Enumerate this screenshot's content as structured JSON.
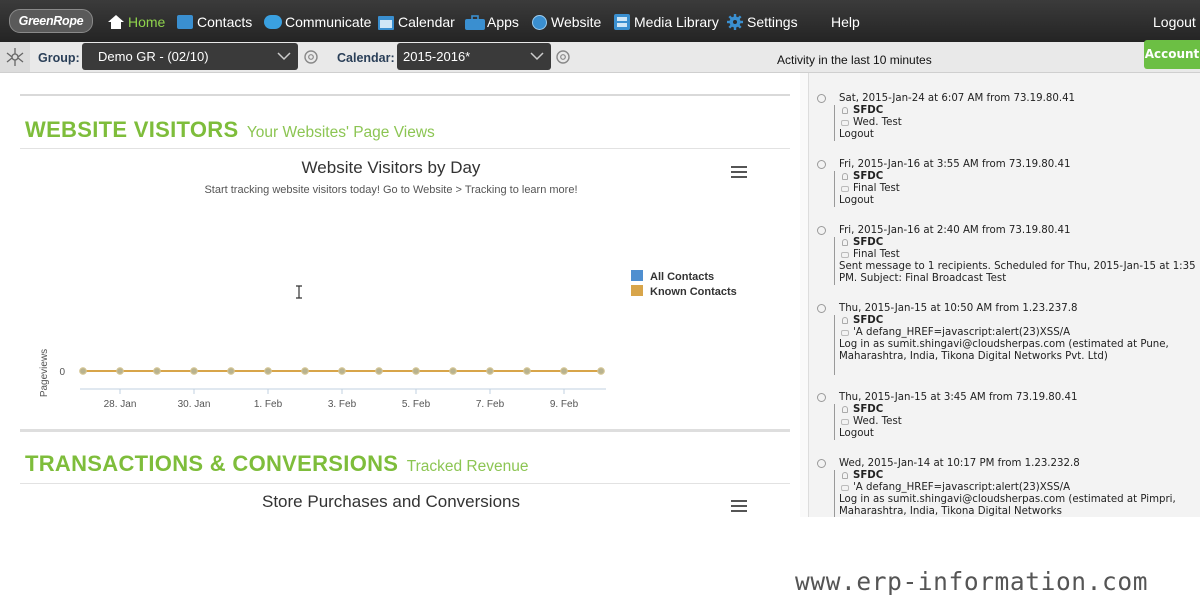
{
  "app": {
    "logo": "GreenRope"
  },
  "nav": {
    "items": [
      {
        "label": "Home",
        "icon": "home-icon"
      },
      {
        "label": "Contacts",
        "icon": "contacts-icon"
      },
      {
        "label": "Communicate",
        "icon": "chat-bubble-icon"
      },
      {
        "label": "Calendar",
        "icon": "calendar-icon"
      },
      {
        "label": "Apps",
        "icon": "briefcase-icon"
      },
      {
        "label": "Website",
        "icon": "globe-icon"
      },
      {
        "label": "Media Library",
        "icon": "media-icon"
      },
      {
        "label": "Settings",
        "icon": "gear-icon"
      },
      {
        "label": "Help",
        "icon": ""
      }
    ],
    "logout": "Logout"
  },
  "subbar": {
    "group_label": "Group:",
    "group_value": "Demo GR - (02/10)",
    "calendar_label": "Calendar:",
    "calendar_value": "2015-2016*",
    "activity_title": "Activity in the last 10 minutes",
    "account_button": "Account"
  },
  "sections": [
    {
      "title": "WEBSITE VISITORS",
      "subtitle": "Your Websites' Page Views"
    },
    {
      "title": "TRANSACTIONS & CONVERSIONS",
      "subtitle": "Tracked Revenue"
    }
  ],
  "chart_data": {
    "type": "line",
    "title": "Website Visitors by Day",
    "subtitle": "Start tracking website visitors today! Go to Website > Tracking to learn more!",
    "ylabel": "Pageviews",
    "xlabel": "",
    "x_tick_labels": [
      "28. Jan",
      "30. Jan",
      "1. Feb",
      "3. Feb",
      "5. Feb",
      "7. Feb",
      "9. Feb"
    ],
    "x_start_day": 27,
    "x_end_day": 41,
    "y_ticks": [
      0
    ],
    "series": [
      {
        "name": "All Contacts",
        "color": "#4f8fd0",
        "values": [
          0,
          0,
          0,
          0,
          0,
          0,
          0,
          0,
          0,
          0,
          0,
          0,
          0,
          0,
          0
        ]
      },
      {
        "name": "Known Contacts",
        "color": "#d8a54a",
        "values": [
          0,
          0,
          0,
          0,
          0,
          0,
          0,
          0,
          0,
          0,
          0,
          0,
          0,
          0,
          0
        ]
      }
    ],
    "legend_position": "right",
    "grid": false
  },
  "second_chart": {
    "title": "Store Purchases and Conversions"
  },
  "activity": [
    {
      "header": "Sat, 2015-Jan-24 at 6:07 AM from 73.19.80.41",
      "user": "SFDC",
      "context": "Wed. Test",
      "message": "Logout"
    },
    {
      "header": "Fri, 2015-Jan-16 at 3:55 AM from 73.19.80.41",
      "user": "SFDC",
      "context": "Final Test",
      "message": "Logout"
    },
    {
      "header": "Fri, 2015-Jan-16 at 2:40 AM from 73.19.80.41",
      "user": "SFDC",
      "context": "Final Test",
      "message": "Sent message to 1 recipients. Scheduled for Thu, 2015-Jan-15 at 1:35 PM. Subject: Final Broadcast Test"
    },
    {
      "header": "Thu, 2015-Jan-15 at 10:50 AM from 1.23.237.8",
      "user": "SFDC",
      "context": "'A defang_HREF=javascript:alert(23)XSS/A",
      "message": "Log in as sumit.shingavi@cloudsherpas.com (estimated at Pune, Maharashtra, India, Tikona Digital Networks Pvt. Ltd)"
    },
    {
      "header": "Thu, 2015-Jan-15 at 3:45 AM from 73.19.80.41",
      "user": "SFDC",
      "context": "Wed. Test",
      "message": "Logout"
    },
    {
      "header": "Wed, 2015-Jan-14 at 10:17 PM from 1.23.232.8",
      "user": "SFDC",
      "context": "'A defang_HREF=javascript:alert(23)XSS/A",
      "message": "Log in as sumit.shingavi@cloudsherpas.com (estimated at Pimpri, Maharashtra, India, Tikona Digital Networks"
    }
  ],
  "watermark": "www.erp-information.com"
}
